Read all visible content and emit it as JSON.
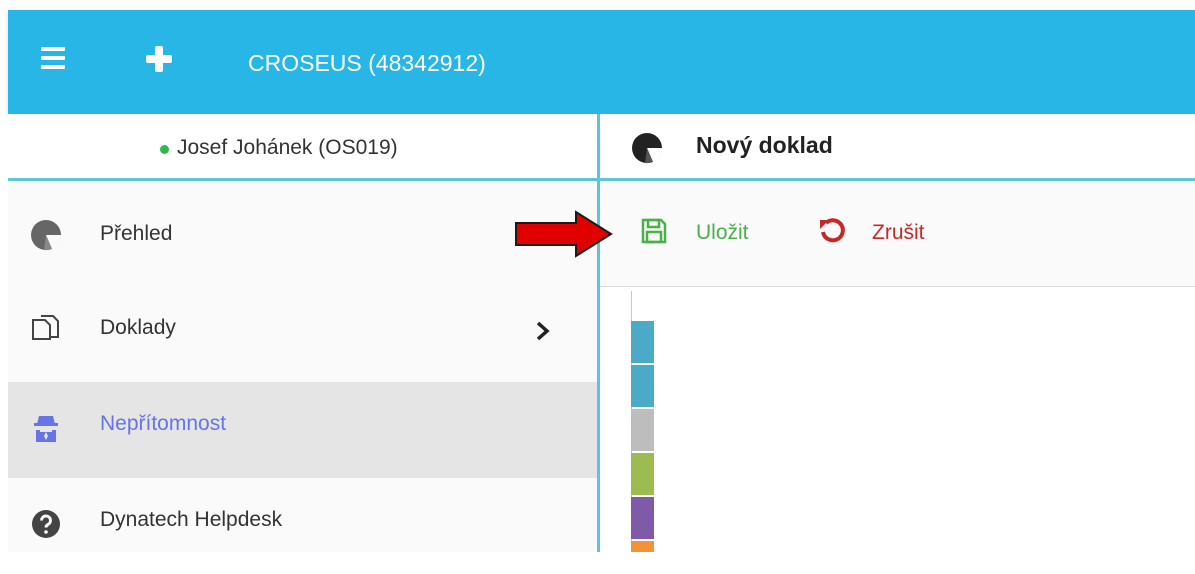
{
  "header": {
    "title": "CROSEUS (48342912)",
    "menu_icon": "hamburger-menu-icon",
    "add_icon": "plus-icon",
    "background_color": "#27b6e6"
  },
  "sidebar": {
    "user": {
      "name": "Josef Johánek (OS019)",
      "status": "online",
      "status_color": "#2fb84c"
    },
    "items": [
      {
        "label": "Přehled",
        "icon": "pie-chart-icon",
        "active": false
      },
      {
        "label": "Doklady",
        "icon": "documents-icon",
        "active": false,
        "has_submenu": true
      },
      {
        "label": "Nepřítomnost",
        "icon": "spy-icon",
        "active": true
      },
      {
        "label": "Dynatech Helpdesk",
        "icon": "question-circle-icon",
        "active": false
      }
    ],
    "active_color": "#6674e6"
  },
  "main": {
    "title": "Nový doklad",
    "logo_icon": "pie-chart-logo-icon",
    "toolbar": {
      "save_label": "Uložit",
      "save_icon": "floppy-disk-icon",
      "save_color": "#4ab04a",
      "cancel_label": "Zrušit",
      "cancel_icon": "undo-icon",
      "cancel_color": "#c62828"
    },
    "color_stripes": [
      "#4aaac7",
      "#4aaac7",
      "#bdbdbd",
      "#9cbc52",
      "#7e5aa8",
      "#f4923a"
    ]
  },
  "annotation": {
    "arrow_icon": "red-arrow-icon",
    "arrow_color": "#e00000"
  }
}
